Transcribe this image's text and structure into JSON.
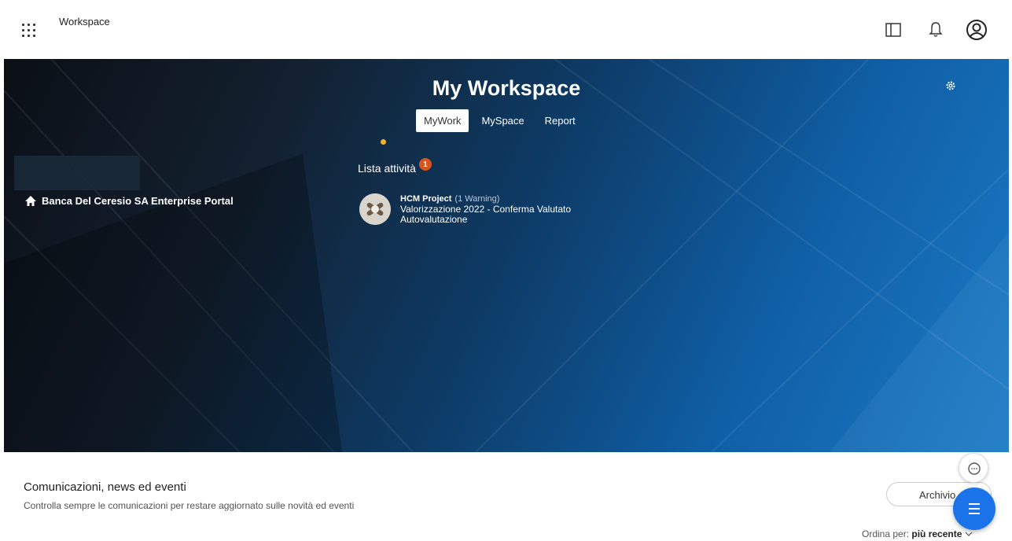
{
  "header": {
    "app_title": "Workspace"
  },
  "hero": {
    "title": "My Workspace",
    "tabs": [
      {
        "label": "MyWork",
        "active": true
      },
      {
        "label": "MySpace",
        "active": false
      },
      {
        "label": "Report",
        "active": false
      }
    ],
    "portal_link": "Banca Del Ceresio SA Enterprise Portal",
    "tasks": {
      "heading": "Lista attività",
      "badge_count": "1",
      "items": [
        {
          "title": "HCM Project",
          "warning": "(1 Warning)",
          "line1": "Valorizzazione 2022 - Conferma Valutato",
          "line2": "Autovalutazione"
        }
      ]
    }
  },
  "news": {
    "title": "Comunicazioni, news ed eventi",
    "subtitle": "Controlla sempre le comunicazioni per restare aggiornato sulle novità ed eventi",
    "archive_label": "Archivio",
    "sort_label": "Ordina per:",
    "sort_value": "più recente"
  },
  "colors": {
    "badge": "#d9531e",
    "fab": "#1a73e8",
    "status_dot": "#f0b429"
  },
  "icons": [
    "apps-grid-icon",
    "side-panel-icon",
    "bell-icon",
    "user-circle-icon",
    "gear-icon",
    "home-icon",
    "chat-icon",
    "menu-icon",
    "chevron-down-icon"
  ]
}
